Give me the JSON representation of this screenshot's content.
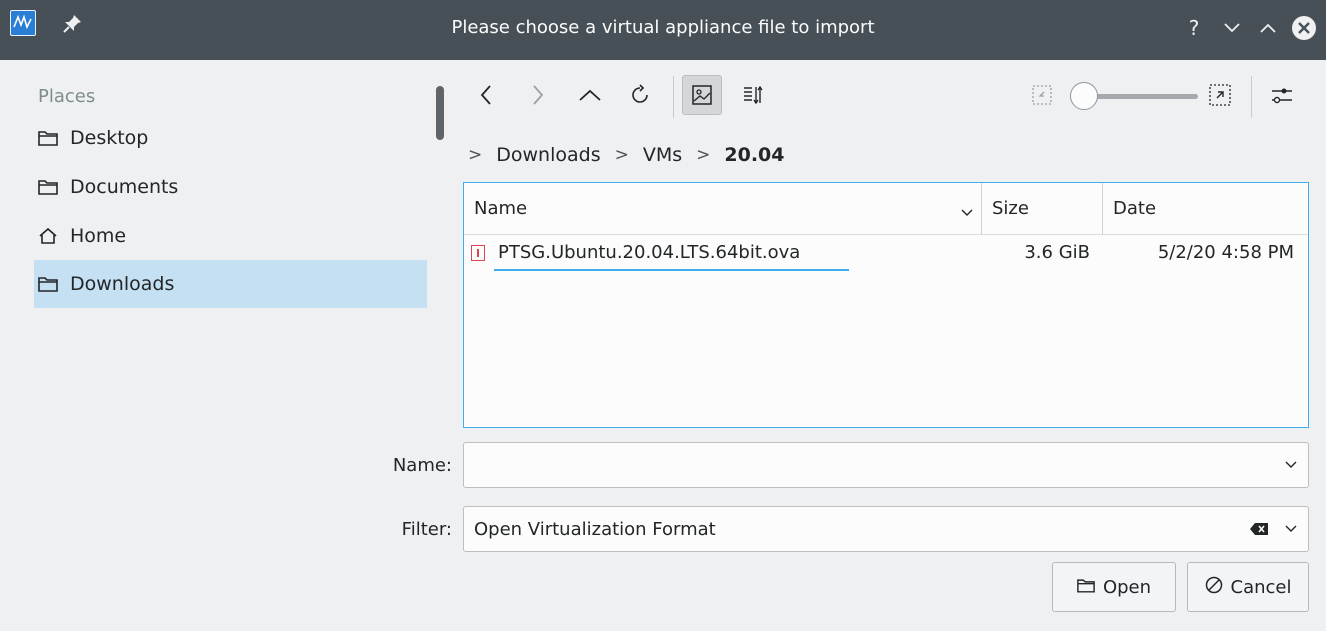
{
  "window": {
    "title": "Please choose a virtual appliance file to import",
    "app_icon": "virtualbox-icon",
    "controls": {
      "help": "?",
      "minimize": "chevron-down-icon",
      "maximize": "chevron-up-icon",
      "close": "close-circle-icon"
    }
  },
  "places": {
    "label": "Places",
    "items": [
      {
        "label": "Desktop",
        "icon": "folder-icon"
      },
      {
        "label": "Documents",
        "icon": "folder-icon"
      },
      {
        "label": "Home",
        "icon": "home-icon"
      },
      {
        "label": "Downloads",
        "icon": "folder-icon",
        "selected": true
      }
    ]
  },
  "toolbar": {
    "buttons": [
      "back-icon",
      "forward-icon",
      "up-icon",
      "reload-icon",
      "preview-icon",
      "sort-icon"
    ],
    "zoom_level": 0
  },
  "breadcrumb": {
    "items": [
      "Downloads",
      "VMs",
      "20.04"
    ]
  },
  "files": {
    "columns": [
      "Name",
      "Size",
      "Date"
    ],
    "rows": [
      {
        "name": "PTSG.Ubuntu.20.04.LTS.64bit.ova",
        "size": "3.6 GiB",
        "date": "5/2/20 4:58 PM"
      }
    ]
  },
  "form": {
    "name_label": "Name:",
    "name_value": "",
    "filter_label": "Filter:",
    "filter_value": "Open Virtualization Format"
  },
  "buttons": {
    "open": "Open",
    "cancel": "Cancel"
  },
  "colors": {
    "selection": "#c5dff3",
    "accent": "#3daee9",
    "titlebar": "#475057"
  }
}
